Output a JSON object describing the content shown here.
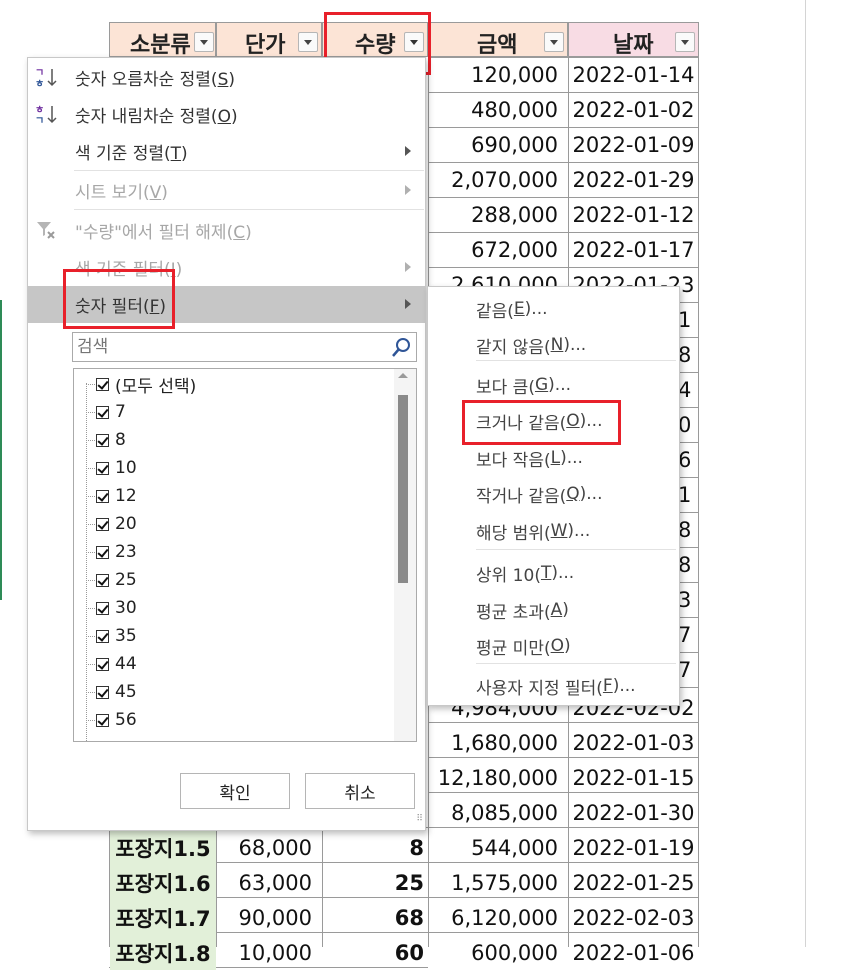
{
  "headers": {
    "subcategory": "소분류",
    "unit_price": "단가",
    "quantity": "수량",
    "amount": "금액",
    "date": "날짜"
  },
  "visible_rows": [
    {
      "amount": "120,000",
      "date": "2022-01-14"
    },
    {
      "amount": "480,000",
      "date": "2022-01-02"
    },
    {
      "amount": "690,000",
      "date": "2022-01-09"
    },
    {
      "amount": "2,070,000",
      "date": "2022-01-29"
    },
    {
      "amount": "288,000",
      "date": "2022-01-12"
    },
    {
      "amount": "672,000",
      "date": "2022-01-17"
    },
    {
      "amount": "2,610,000",
      "date": "2022-01-23"
    }
  ],
  "partial_date_digits": [
    "1",
    "8",
    "4",
    "0",
    "6",
    "1",
    "8",
    "8",
    "3",
    "7",
    "7"
  ],
  "lower_rows": [
    {
      "amount": "4,984,000",
      "date": "2022-02-02"
    },
    {
      "amount": "1,680,000",
      "date": "2022-01-03"
    },
    {
      "amount": "12,180,000",
      "date": "2022-01-15"
    },
    {
      "amount": "8,085,000",
      "date": "2022-01-30"
    }
  ],
  "bottom_rows": [
    {
      "subcategory": "포장지1.5",
      "unit_price": "68,000",
      "quantity": "8",
      "amount": "544,000",
      "date": "2022-01-19"
    },
    {
      "subcategory": "포장지1.6",
      "unit_price": "63,000",
      "quantity": "25",
      "amount": "1,575,000",
      "date": "2022-01-25"
    },
    {
      "subcategory": "포장지1.7",
      "unit_price": "90,000",
      "quantity": "68",
      "amount": "6,120,000",
      "date": "2022-02-03"
    },
    {
      "subcategory": "포장지1.8",
      "unit_price": "10,000",
      "quantity": "60",
      "amount": "600,000",
      "date": "2022-01-06"
    }
  ],
  "filter_menu": {
    "sort_asc": {
      "text": "숫자 오름차순 정렬(",
      "key": "S",
      "end": ")"
    },
    "sort_desc": {
      "text": "숫자 내림차순 정렬(",
      "key": "O",
      "end": ")"
    },
    "sort_color": {
      "text": "색 기준 정렬(",
      "key": "T",
      "end": ")"
    },
    "sheet_view": {
      "text": "시트 보기(",
      "key": "V",
      "end": ")"
    },
    "clear_filter": {
      "text": "\"수량\"에서 필터 해제(",
      "key": "C",
      "end": ")"
    },
    "color_filter": {
      "text": "색 기준 필터(",
      "key": "I",
      "end": ")"
    },
    "number_filter": {
      "text": "숫자 필터(",
      "key": "F",
      "end": ")"
    },
    "search_placeholder": "검색",
    "select_all": "(모두 선택)",
    "values": [
      "7",
      "8",
      "10",
      "12",
      "20",
      "23",
      "25",
      "30",
      "35",
      "44",
      "45",
      "56"
    ],
    "ok_button": "확인",
    "cancel_button": "취소"
  },
  "number_filter_submenu": [
    {
      "text": "같음(",
      "key": "E",
      "end": ")..."
    },
    {
      "text": "같지 않음(",
      "key": "N",
      "end": ")..."
    },
    {
      "text": "보다 큼(",
      "key": "G",
      "end": ")..."
    },
    {
      "text": "크거나 같음(",
      "key": "O",
      "end": ")..."
    },
    {
      "text": "보다 작음(",
      "key": "L",
      "end": ")..."
    },
    {
      "text": "작거나 같음(",
      "key": "Q",
      "end": ")..."
    },
    {
      "text": "해당 범위(",
      "key": "W",
      "end": ")..."
    },
    {
      "text": "상위 10(",
      "key": "T",
      "end": ")..."
    },
    {
      "text": "평균 초과(",
      "key": "A",
      "end": ")"
    },
    {
      "text": "평균 미만(",
      "key": "O",
      "end": ")"
    },
    {
      "text": "사용자 지정 필터(",
      "key": "F",
      "end": ")..."
    }
  ],
  "colors": {
    "header_subcategory_bg": "#fce4d6",
    "header_date_bg": "#f8dce4",
    "subcategory_cell_bg": "#e2f0d9",
    "highlight_red": "#e8202a",
    "active_menu_bg": "#c6c6c6"
  }
}
